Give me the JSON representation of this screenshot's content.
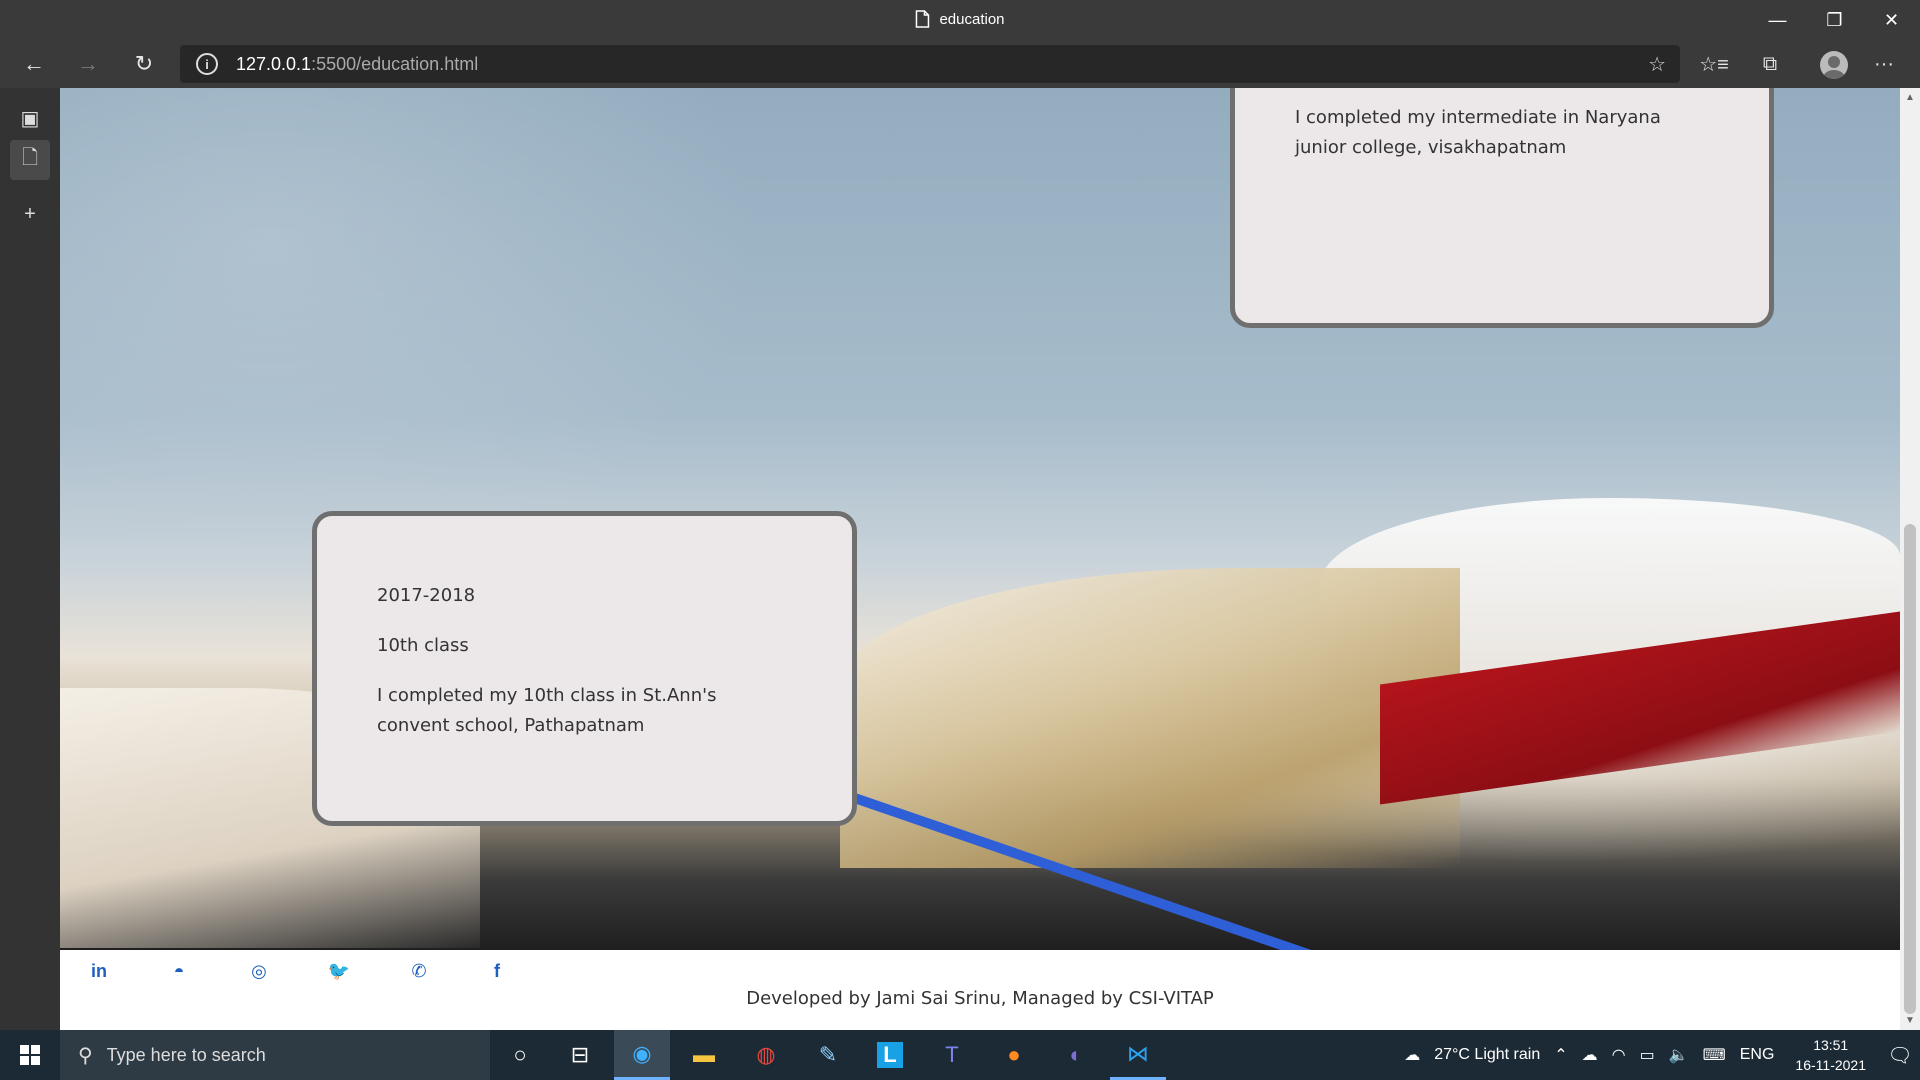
{
  "browser": {
    "tab_title": "education",
    "url_host": "127.0.0.1",
    "url_path": ":5500/education.html",
    "icons": [
      "back-icon",
      "forward-icon",
      "refresh-icon",
      "info-icon",
      "add-favorite-icon",
      "favorites-icon",
      "collections-icon",
      "profile-icon",
      "more-icon"
    ],
    "window_controls": {
      "minimize": "—",
      "restore": "❐",
      "close": "✕"
    }
  },
  "page": {
    "cards": [
      {
        "description": "I completed my intermediate in Naryana junior college, visakhapatnam"
      },
      {
        "year": "2017-2018",
        "title": "10th class",
        "description": "I completed my 10th class in St.Ann's convent school, Pathapatnam"
      }
    ],
    "social_links": [
      {
        "name": "linkedin",
        "glyph": "in"
      },
      {
        "name": "github",
        "glyph": "◓"
      },
      {
        "name": "instagram",
        "glyph": "◎"
      },
      {
        "name": "twitter",
        "glyph": "🐦"
      },
      {
        "name": "whatsapp",
        "glyph": "✆"
      },
      {
        "name": "facebook",
        "glyph": "f"
      }
    ],
    "footer_text": "Developed by Jami Sai Srinu, Managed by CSI-VITAP"
  },
  "taskbar": {
    "search_placeholder": "Type here to search",
    "weather": "27°C  Light rain",
    "language": "ENG",
    "time": "13:51",
    "date": "16-11-2021",
    "apps": [
      "cortana",
      "task-view",
      "edge",
      "file-explorer",
      "chrome",
      "paint",
      "app-l",
      "teams",
      "firefox",
      "eclipse",
      "vscode"
    ]
  }
}
